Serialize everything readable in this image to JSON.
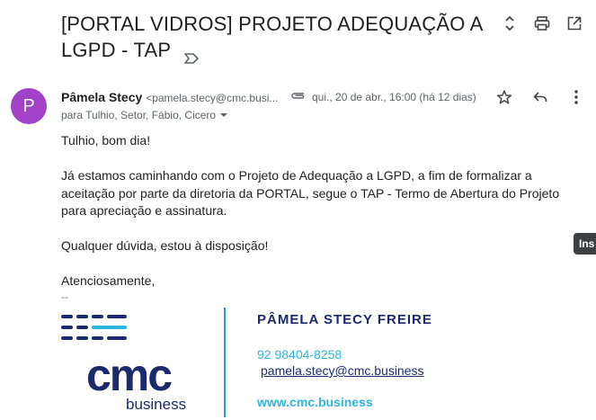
{
  "email": {
    "subject": "[PORTAL VIDROS] PROJETO ADEQUAÇÃO A LGPD - TAP",
    "sender": {
      "initial": "P",
      "name": "Pâmela Stecy",
      "email": "<pamela.stecy@cmc.busi..."
    },
    "date": "qui., 20 de abr., 16:00 (há 12 dias)",
    "recipients": "para Tulhio, Setor, Fábio, Cicero",
    "body": {
      "greeting": "Tulhio, bom dia!",
      "paragraph1": "Já estamos caminhando com o Projeto de Adequação a LGPD, a fim de formalizar a aceitação por parte da diretoria da PORTAL, segue o TAP - Termo de Abertura do Projeto para apreciação e assinatura.",
      "paragraph2": "Qualquer dúvida, estou à disposição!",
      "closing": "Atenciosamente,",
      "separator": "--"
    },
    "signature": {
      "name": "PÂMELA STECY FREIRE",
      "phone": "92 98404-8258",
      "email": "pamela.stecy@cmc.business",
      "website": "www.cmc.business",
      "logo_main": "cmc",
      "logo_sub": "business"
    },
    "tooltip": "Ins",
    "colors": {
      "avatar": "#a142c9",
      "logo_navy": "#1b2a6b",
      "logo_cyan": "#2fb5e0"
    },
    "icons": {
      "label": "label-arrow-icon",
      "expand": "unfold-icon",
      "print": "printer-icon",
      "popout": "open-in-new-icon",
      "attachment": "paperclip-icon",
      "star": "star-icon",
      "reply": "reply-icon",
      "more": "more-vert-icon",
      "dropdown": "caret-down-icon"
    }
  }
}
